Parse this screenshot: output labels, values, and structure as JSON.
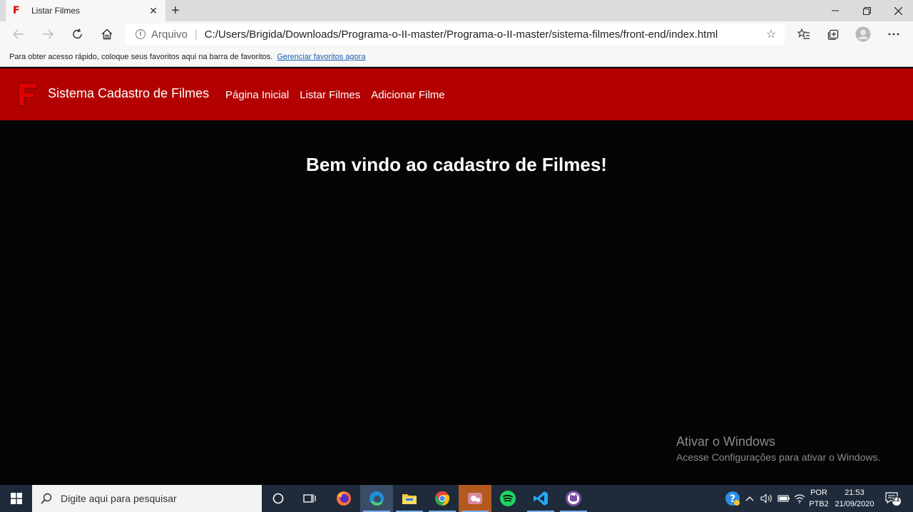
{
  "browser": {
    "tab_title": "Listar Filmes",
    "address_scheme": "Arquivo",
    "address_url": "C:/Users/Brigida/Downloads/Programa-o-II-master/Programa-o-II-master/sistema-filmes/front-end/index.html",
    "favorites_hint": "Para obter acesso rápido, coloque seus favoritos aqui na barra de favoritos.",
    "favorites_link": "Gerenciar favoritos agora"
  },
  "site": {
    "brand": "Sistema Cadastro de Filmes",
    "nav": [
      "Página Inicial",
      "Listar Filmes",
      "Adicionar Filme"
    ],
    "welcome": "Bem vindo ao cadastro de Filmes!",
    "accent_color": "#b30000"
  },
  "watermark": {
    "title": "Ativar o Windows",
    "subtitle": "Acesse Configurações para ativar o Windows."
  },
  "taskbar": {
    "search_placeholder": "Digite aqui para pesquisar",
    "lang_top": "POR",
    "lang_bottom": "PTB2",
    "time": "21:53",
    "date": "21/09/2020",
    "notifications": "21"
  }
}
